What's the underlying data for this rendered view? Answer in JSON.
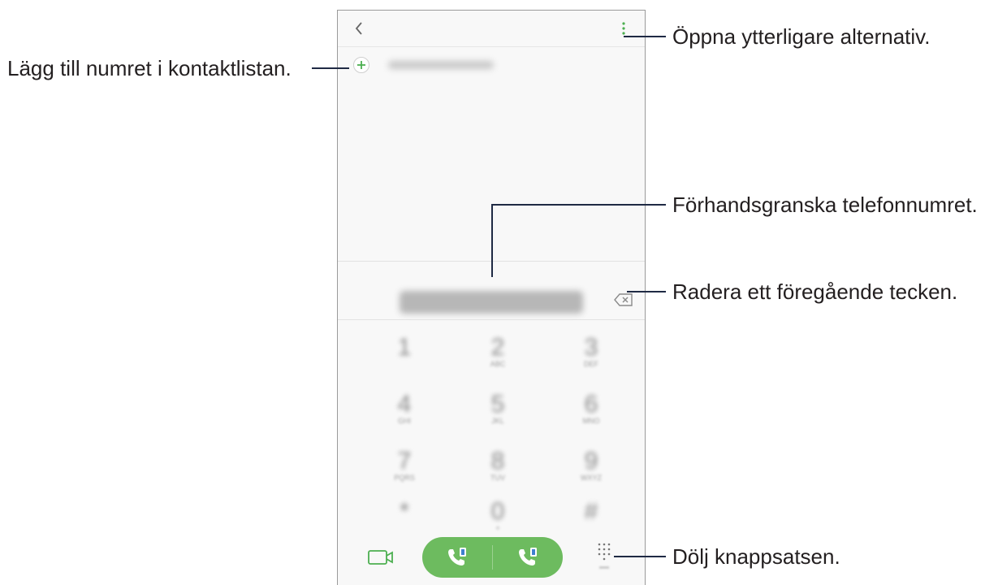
{
  "annotations": {
    "more_options": "Öppna ytterligare alternativ.",
    "add_contact": "Lägg till numret i kontaktlistan.",
    "preview_number": "Förhandsgranska telefonnumret.",
    "delete_char": "Radera ett föregående tecken.",
    "hide_keypad": "Dölj knappsatsen."
  },
  "keypad": {
    "keys": [
      {
        "digit": "1",
        "letters": ""
      },
      {
        "digit": "2",
        "letters": "ABC"
      },
      {
        "digit": "3",
        "letters": "DEF"
      },
      {
        "digit": "4",
        "letters": "GHI"
      },
      {
        "digit": "5",
        "letters": "JKL"
      },
      {
        "digit": "6",
        "letters": "MNO"
      },
      {
        "digit": "7",
        "letters": "PQRS"
      },
      {
        "digit": "8",
        "letters": "TUV"
      },
      {
        "digit": "9",
        "letters": "WXYZ"
      },
      {
        "digit": "*",
        "letters": ""
      },
      {
        "digit": "0",
        "letters": "+"
      },
      {
        "digit": "#",
        "letters": ""
      }
    ]
  },
  "colors": {
    "accent_green": "#6dbb5f",
    "icon_green": "#4caf50",
    "leader_line": "#1f2a44"
  },
  "icons": {
    "back": "chevron-left-icon",
    "more": "more-vertical-icon",
    "add": "plus-circle-icon",
    "backspace": "backspace-icon",
    "video_call": "video-camera-icon",
    "call": "phone-sim-icon",
    "keypad_toggle": "keypad-grid-icon"
  }
}
